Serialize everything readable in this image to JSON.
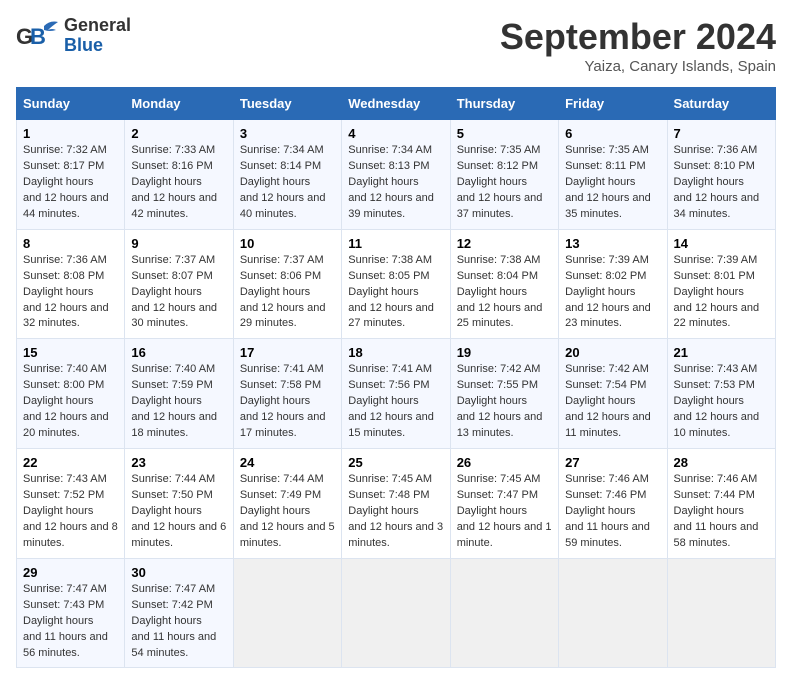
{
  "header": {
    "logo_line1": "General",
    "logo_line2": "Blue",
    "month": "September 2024",
    "location": "Yaiza, Canary Islands, Spain"
  },
  "columns": [
    "Sunday",
    "Monday",
    "Tuesday",
    "Wednesday",
    "Thursday",
    "Friday",
    "Saturday"
  ],
  "weeks": [
    [
      {
        "day": "1",
        "sunrise": "7:32 AM",
        "sunset": "8:17 PM",
        "daylight": "12 hours and 44 minutes."
      },
      {
        "day": "2",
        "sunrise": "7:33 AM",
        "sunset": "8:16 PM",
        "daylight": "12 hours and 42 minutes."
      },
      {
        "day": "3",
        "sunrise": "7:34 AM",
        "sunset": "8:14 PM",
        "daylight": "12 hours and 40 minutes."
      },
      {
        "day": "4",
        "sunrise": "7:34 AM",
        "sunset": "8:13 PM",
        "daylight": "12 hours and 39 minutes."
      },
      {
        "day": "5",
        "sunrise": "7:35 AM",
        "sunset": "8:12 PM",
        "daylight": "12 hours and 37 minutes."
      },
      {
        "day": "6",
        "sunrise": "7:35 AM",
        "sunset": "8:11 PM",
        "daylight": "12 hours and 35 minutes."
      },
      {
        "day": "7",
        "sunrise": "7:36 AM",
        "sunset": "8:10 PM",
        "daylight": "12 hours and 34 minutes."
      }
    ],
    [
      {
        "day": "8",
        "sunrise": "7:36 AM",
        "sunset": "8:08 PM",
        "daylight": "12 hours and 32 minutes."
      },
      {
        "day": "9",
        "sunrise": "7:37 AM",
        "sunset": "8:07 PM",
        "daylight": "12 hours and 30 minutes."
      },
      {
        "day": "10",
        "sunrise": "7:37 AM",
        "sunset": "8:06 PM",
        "daylight": "12 hours and 29 minutes."
      },
      {
        "day": "11",
        "sunrise": "7:38 AM",
        "sunset": "8:05 PM",
        "daylight": "12 hours and 27 minutes."
      },
      {
        "day": "12",
        "sunrise": "7:38 AM",
        "sunset": "8:04 PM",
        "daylight": "12 hours and 25 minutes."
      },
      {
        "day": "13",
        "sunrise": "7:39 AM",
        "sunset": "8:02 PM",
        "daylight": "12 hours and 23 minutes."
      },
      {
        "day": "14",
        "sunrise": "7:39 AM",
        "sunset": "8:01 PM",
        "daylight": "12 hours and 22 minutes."
      }
    ],
    [
      {
        "day": "15",
        "sunrise": "7:40 AM",
        "sunset": "8:00 PM",
        "daylight": "12 hours and 20 minutes."
      },
      {
        "day": "16",
        "sunrise": "7:40 AM",
        "sunset": "7:59 PM",
        "daylight": "12 hours and 18 minutes."
      },
      {
        "day": "17",
        "sunrise": "7:41 AM",
        "sunset": "7:58 PM",
        "daylight": "12 hours and 17 minutes."
      },
      {
        "day": "18",
        "sunrise": "7:41 AM",
        "sunset": "7:56 PM",
        "daylight": "12 hours and 15 minutes."
      },
      {
        "day": "19",
        "sunrise": "7:42 AM",
        "sunset": "7:55 PM",
        "daylight": "12 hours and 13 minutes."
      },
      {
        "day": "20",
        "sunrise": "7:42 AM",
        "sunset": "7:54 PM",
        "daylight": "12 hours and 11 minutes."
      },
      {
        "day": "21",
        "sunrise": "7:43 AM",
        "sunset": "7:53 PM",
        "daylight": "12 hours and 10 minutes."
      }
    ],
    [
      {
        "day": "22",
        "sunrise": "7:43 AM",
        "sunset": "7:52 PM",
        "daylight": "12 hours and 8 minutes."
      },
      {
        "day": "23",
        "sunrise": "7:44 AM",
        "sunset": "7:50 PM",
        "daylight": "12 hours and 6 minutes."
      },
      {
        "day": "24",
        "sunrise": "7:44 AM",
        "sunset": "7:49 PM",
        "daylight": "12 hours and 5 minutes."
      },
      {
        "day": "25",
        "sunrise": "7:45 AM",
        "sunset": "7:48 PM",
        "daylight": "12 hours and 3 minutes."
      },
      {
        "day": "26",
        "sunrise": "7:45 AM",
        "sunset": "7:47 PM",
        "daylight": "12 hours and 1 minute."
      },
      {
        "day": "27",
        "sunrise": "7:46 AM",
        "sunset": "7:46 PM",
        "daylight": "11 hours and 59 minutes."
      },
      {
        "day": "28",
        "sunrise": "7:46 AM",
        "sunset": "7:44 PM",
        "daylight": "11 hours and 58 minutes."
      }
    ],
    [
      {
        "day": "29",
        "sunrise": "7:47 AM",
        "sunset": "7:43 PM",
        "daylight": "11 hours and 56 minutes."
      },
      {
        "day": "30",
        "sunrise": "7:47 AM",
        "sunset": "7:42 PM",
        "daylight": "11 hours and 54 minutes."
      },
      null,
      null,
      null,
      null,
      null
    ]
  ]
}
